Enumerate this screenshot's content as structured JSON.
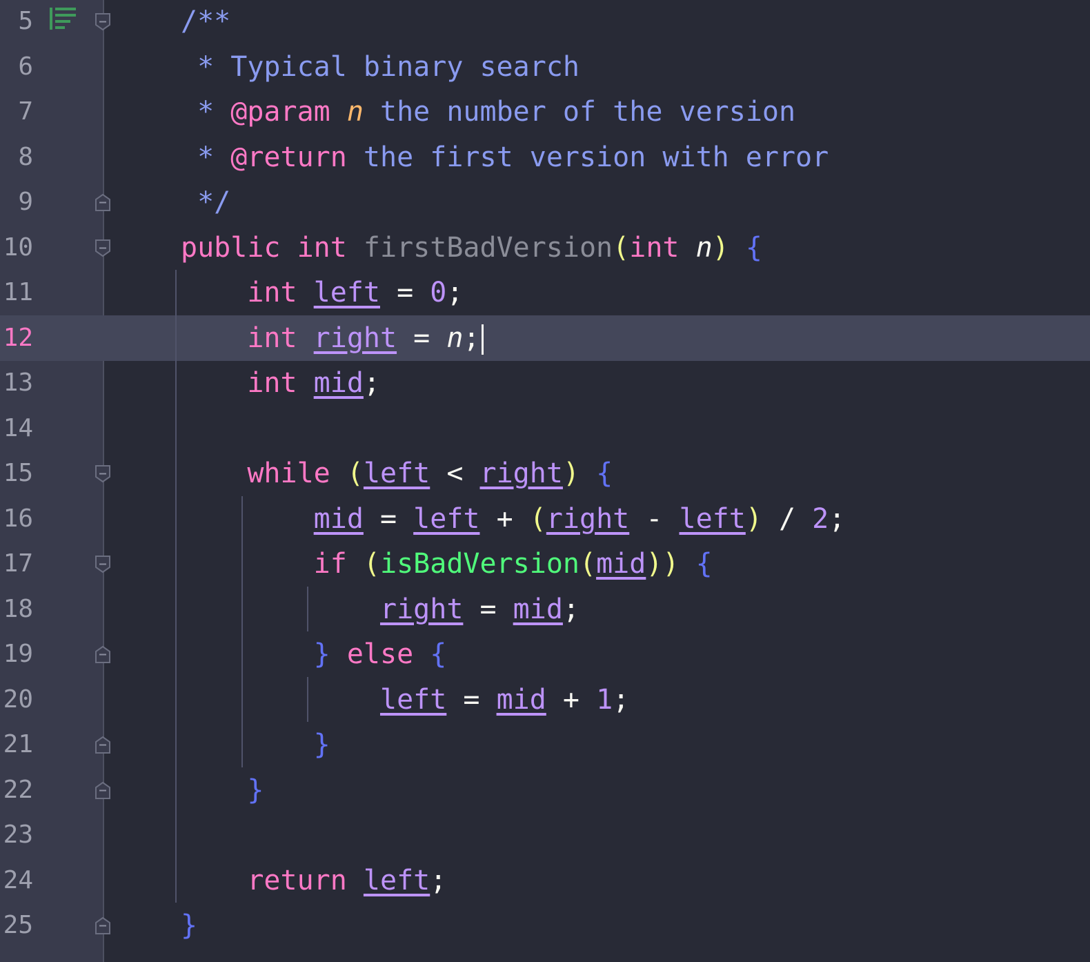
{
  "editor": {
    "current_line": 12,
    "lines": [
      {
        "number": "5",
        "fold": "start",
        "bookmark": true,
        "tokens": [
          {
            "t": "/**",
            "c": "cm"
          }
        ]
      },
      {
        "number": "6",
        "tokens": [
          {
            "t": " * Typical binary search",
            "c": "cm"
          }
        ]
      },
      {
        "number": "7",
        "tokens": [
          {
            "t": " * ",
            "c": "cm"
          },
          {
            "t": "@param",
            "c": "tag"
          },
          {
            "t": " ",
            "c": "cm"
          },
          {
            "t": "n",
            "c": "pn"
          },
          {
            "t": " the number of the version",
            "c": "cm"
          }
        ]
      },
      {
        "number": "8",
        "tokens": [
          {
            "t": " * ",
            "c": "cm"
          },
          {
            "t": "@return",
            "c": "tag"
          },
          {
            "t": " the first version with error",
            "c": "cm"
          }
        ]
      },
      {
        "number": "9",
        "fold": "end",
        "tokens": [
          {
            "t": " */",
            "c": "cm"
          }
        ]
      },
      {
        "number": "10",
        "fold": "start",
        "tokens": [
          {
            "t": "public int ",
            "c": "kw"
          },
          {
            "t": "firstBadVersion",
            "c": "fn"
          },
          {
            "t": "(",
            "c": "p1"
          },
          {
            "t": "int ",
            "c": "kw"
          },
          {
            "t": "n",
            "c": "par"
          },
          {
            "t": ")",
            "c": "p1"
          },
          {
            "t": " ",
            "c": "def"
          },
          {
            "t": "{",
            "c": "p2"
          }
        ]
      },
      {
        "number": "11",
        "tokens": [
          {
            "t": "    ",
            "c": "def"
          },
          {
            "t": "int ",
            "c": "kw"
          },
          {
            "t": "left",
            "c": "var"
          },
          {
            "t": " = ",
            "c": "op"
          },
          {
            "t": "0",
            "c": "num"
          },
          {
            "t": ";",
            "c": "def"
          }
        ]
      },
      {
        "number": "12",
        "caret": true,
        "tokens": [
          {
            "t": "    ",
            "c": "def"
          },
          {
            "t": "int ",
            "c": "kw"
          },
          {
            "t": "right",
            "c": "var"
          },
          {
            "t": " = ",
            "c": "op"
          },
          {
            "t": "n",
            "c": "par"
          },
          {
            "t": ";",
            "c": "def"
          }
        ]
      },
      {
        "number": "13",
        "tokens": [
          {
            "t": "    ",
            "c": "def"
          },
          {
            "t": "int ",
            "c": "kw"
          },
          {
            "t": "mid",
            "c": "var"
          },
          {
            "t": ";",
            "c": "def"
          }
        ]
      },
      {
        "number": "14",
        "tokens": []
      },
      {
        "number": "15",
        "fold": "start",
        "tokens": [
          {
            "t": "    ",
            "c": "def"
          },
          {
            "t": "while",
            "c": "kw"
          },
          {
            "t": " ",
            "c": "def"
          },
          {
            "t": "(",
            "c": "p1"
          },
          {
            "t": "left",
            "c": "var"
          },
          {
            "t": " < ",
            "c": "op"
          },
          {
            "t": "right",
            "c": "var"
          },
          {
            "t": ")",
            "c": "p1"
          },
          {
            "t": " ",
            "c": "def"
          },
          {
            "t": "{",
            "c": "p2"
          }
        ]
      },
      {
        "number": "16",
        "tokens": [
          {
            "t": "        ",
            "c": "def"
          },
          {
            "t": "mid",
            "c": "var"
          },
          {
            "t": " = ",
            "c": "op"
          },
          {
            "t": "left",
            "c": "var"
          },
          {
            "t": " + ",
            "c": "op"
          },
          {
            "t": "(",
            "c": "p1"
          },
          {
            "t": "right",
            "c": "var"
          },
          {
            "t": " - ",
            "c": "op"
          },
          {
            "t": "left",
            "c": "var"
          },
          {
            "t": ")",
            "c": "p1"
          },
          {
            "t": " / ",
            "c": "op"
          },
          {
            "t": "2",
            "c": "num"
          },
          {
            "t": ";",
            "c": "def"
          }
        ]
      },
      {
        "number": "17",
        "fold": "start",
        "tokens": [
          {
            "t": "        ",
            "c": "def"
          },
          {
            "t": "if",
            "c": "kw"
          },
          {
            "t": " ",
            "c": "def"
          },
          {
            "t": "(",
            "c": "p1"
          },
          {
            "t": "isBadVersion",
            "c": "call"
          },
          {
            "t": "(",
            "c": "p1"
          },
          {
            "t": "mid",
            "c": "var"
          },
          {
            "t": "))",
            "c": "p1"
          },
          {
            "t": " ",
            "c": "def"
          },
          {
            "t": "{",
            "c": "p2"
          }
        ]
      },
      {
        "number": "18",
        "tokens": [
          {
            "t": "            ",
            "c": "def"
          },
          {
            "t": "right",
            "c": "var"
          },
          {
            "t": " = ",
            "c": "op"
          },
          {
            "t": "mid",
            "c": "var"
          },
          {
            "t": ";",
            "c": "def"
          }
        ]
      },
      {
        "number": "19",
        "fold": "end",
        "tokens": [
          {
            "t": "        ",
            "c": "def"
          },
          {
            "t": "}",
            "c": "p2"
          },
          {
            "t": " ",
            "c": "def"
          },
          {
            "t": "else",
            "c": "kw"
          },
          {
            "t": " ",
            "c": "def"
          },
          {
            "t": "{",
            "c": "p2"
          }
        ]
      },
      {
        "number": "20",
        "tokens": [
          {
            "t": "            ",
            "c": "def"
          },
          {
            "t": "left",
            "c": "var"
          },
          {
            "t": " = ",
            "c": "op"
          },
          {
            "t": "mid",
            "c": "var"
          },
          {
            "t": " + ",
            "c": "op"
          },
          {
            "t": "1",
            "c": "num"
          },
          {
            "t": ";",
            "c": "def"
          }
        ]
      },
      {
        "number": "21",
        "fold": "end",
        "tokens": [
          {
            "t": "        ",
            "c": "def"
          },
          {
            "t": "}",
            "c": "p2"
          }
        ]
      },
      {
        "number": "22",
        "fold": "end",
        "tokens": [
          {
            "t": "    ",
            "c": "def"
          },
          {
            "t": "}",
            "c": "p2"
          }
        ]
      },
      {
        "number": "23",
        "tokens": []
      },
      {
        "number": "24",
        "tokens": [
          {
            "t": "    ",
            "c": "def"
          },
          {
            "t": "return",
            "c": "kw"
          },
          {
            "t": " ",
            "c": "def"
          },
          {
            "t": "left",
            "c": "var"
          },
          {
            "t": ";",
            "c": "def"
          }
        ]
      },
      {
        "number": "25",
        "fold": "end",
        "tokens": [
          {
            "t": "}",
            "c": "p2"
          }
        ]
      }
    ]
  }
}
